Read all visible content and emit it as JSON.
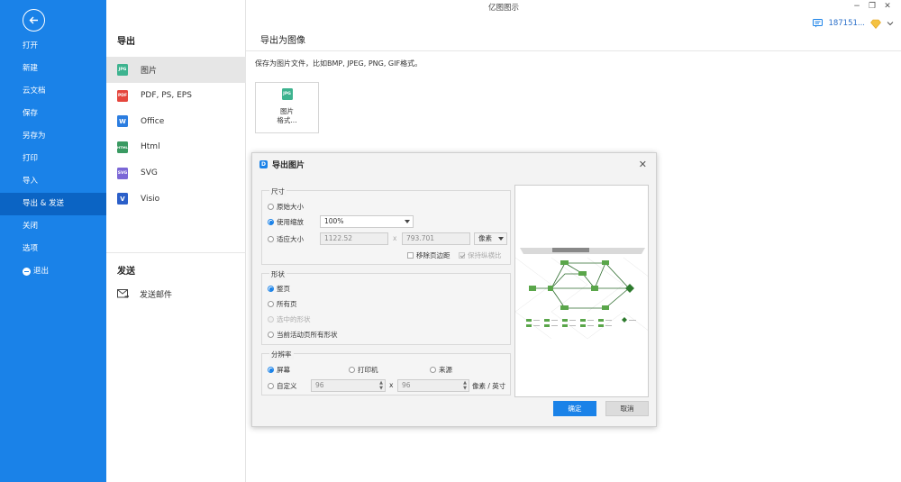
{
  "app": {
    "title": "亿图图示"
  },
  "window": {
    "minimize_icon": "minimize-icon",
    "restore_icon": "restore-icon",
    "close_icon": "close-icon"
  },
  "user": {
    "id": "187151...",
    "message_icon": "message-icon",
    "vip_icon": "diamond-icon"
  },
  "sidebar": {
    "items": [
      {
        "label": "打开"
      },
      {
        "label": "新建"
      },
      {
        "label": "云文档"
      },
      {
        "label": "保存"
      },
      {
        "label": "另存为"
      },
      {
        "label": "打印"
      },
      {
        "label": "导入"
      },
      {
        "label": "导出 & 发送"
      },
      {
        "label": "关闭"
      },
      {
        "label": "选项"
      },
      {
        "label": "退出"
      }
    ],
    "active_index": 7
  },
  "middle": {
    "export_heading": "导出",
    "export_items": [
      {
        "label": "图片",
        "icon": "JPG",
        "color": "#3eb38f"
      },
      {
        "label": "PDF, PS, EPS",
        "icon": "PDF",
        "color": "#e5463d"
      },
      {
        "label": "Office",
        "icon": "W",
        "color": "#2b7de0"
      },
      {
        "label": "Html",
        "icon": "HTML",
        "color": "#3a9a62"
      },
      {
        "label": "SVG",
        "icon": "SVG",
        "color": "#7b67d6"
      },
      {
        "label": "Visio",
        "icon": "V",
        "color": "#2b5fc9"
      }
    ],
    "send_heading": "发送",
    "send_items": [
      {
        "label": "发送邮件",
        "icon": "mail-icon"
      }
    ]
  },
  "right": {
    "heading": "导出为图像",
    "description": "保存为图片文件，比如BMP, JPEG, PNG, GIF格式。",
    "card": {
      "icon": "JPG",
      "line1": "图片",
      "line2": "格式..."
    }
  },
  "dialog": {
    "title": "导出图片",
    "size_group": {
      "title": "尺寸",
      "original": "原始大小",
      "use_zoom": "使用缩放",
      "zoom_value": "100%",
      "fit_size": "适应大小",
      "width": "1122.52",
      "times": "x",
      "height": "793.701",
      "unit": "像素",
      "remove_margin": "移除页边距",
      "keep_ratio": "保持纵横比"
    },
    "shape_group": {
      "title": "形状",
      "options": [
        "整页",
        "所有页",
        "选中的形状",
        "当前活动页所有形状"
      ]
    },
    "resolution_group": {
      "title": "分辨率",
      "screen": "屏幕",
      "printer": "打印机",
      "source": "来源",
      "custom": "自定义",
      "dpi_x": "96",
      "times": "x",
      "dpi_y": "96",
      "unit": "像素 / 英寸"
    },
    "ok": "确定",
    "cancel": "取消"
  },
  "colors": {
    "accent": "#1a82e8",
    "sidebar_active": "#0b64c4",
    "diagram_green": "#5aa64a"
  }
}
